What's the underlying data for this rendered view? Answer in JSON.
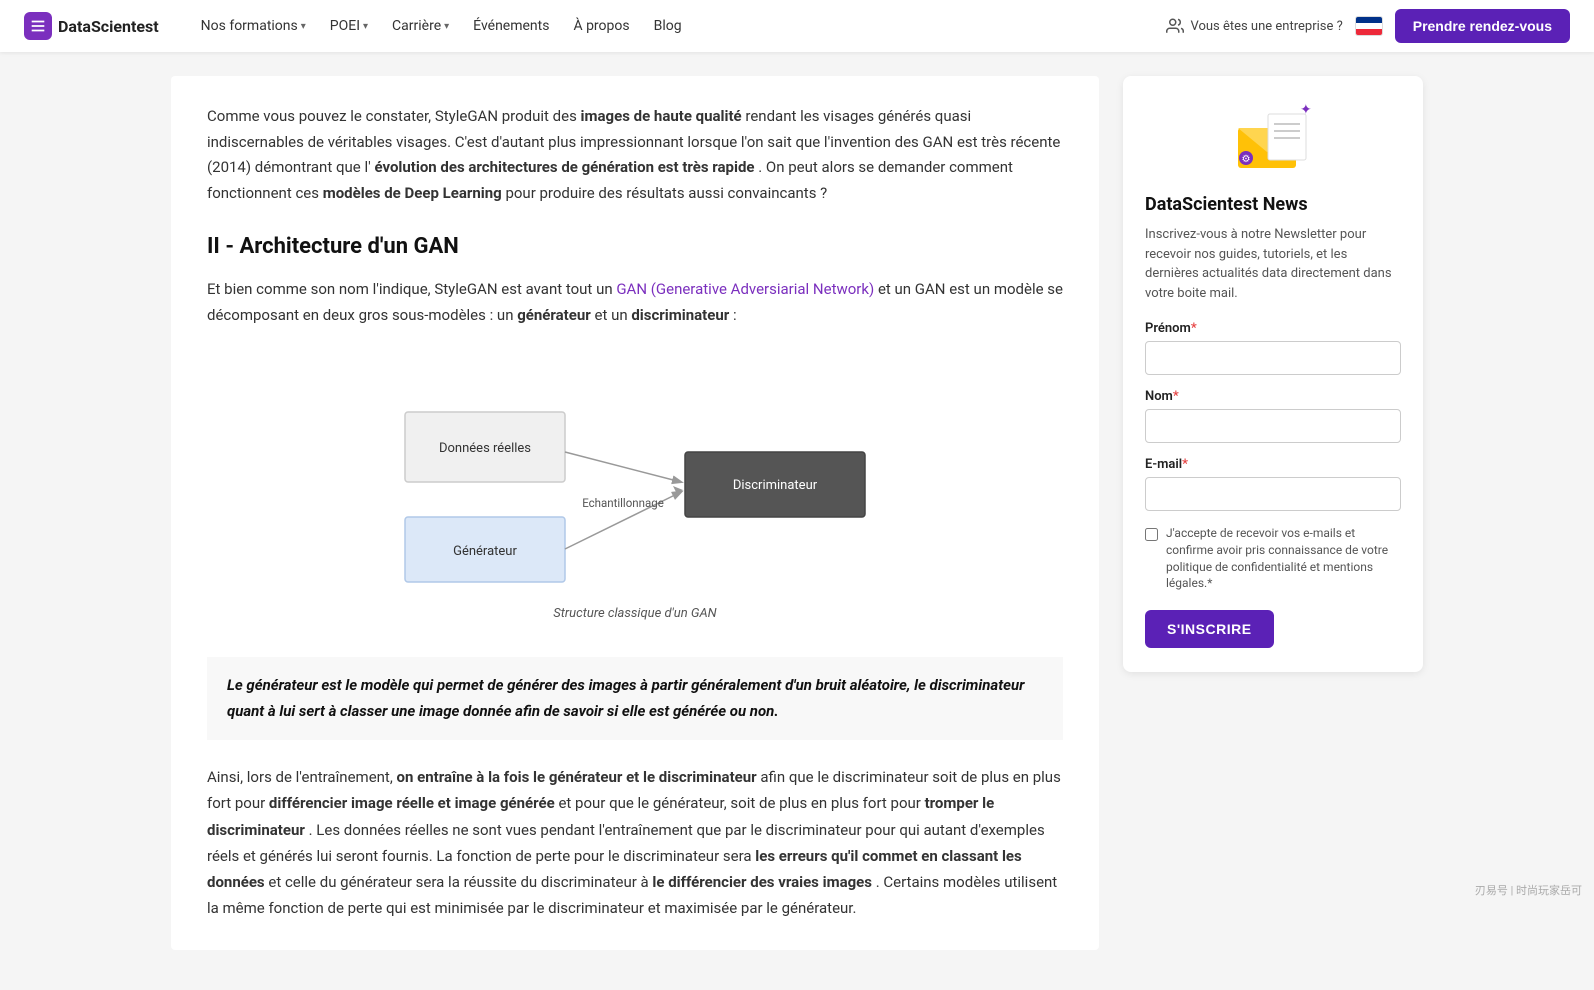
{
  "nav": {
    "logo_text": "DataScientest",
    "links": [
      {
        "label": "Nos formations",
        "has_dropdown": true
      },
      {
        "label": "POEI",
        "has_dropdown": true
      },
      {
        "label": "Carrière",
        "has_dropdown": true
      },
      {
        "label": "Événements",
        "has_dropdown": false
      },
      {
        "label": "À propos",
        "has_dropdown": false
      },
      {
        "label": "Blog",
        "has_dropdown": false
      }
    ],
    "enterprise_label": "Vous êtes une entreprise ?",
    "cta_label": "Prendre rendez-vous"
  },
  "main": {
    "intro_para": {
      "prefix": "Comme vous pouvez le constater, StyleGAN produit des ",
      "bold1": "images de haute qualité",
      "middle1": " rendant les visages générés quasi indiscernables de véritables visages. C'est d'autant plus impressionnant lorsque l'on sait que l'invention des GAN est très récente (2014) démontrant que l'",
      "bold2": "évolution des architectures de génération est très rapide",
      "end": ". On peut alors se demander comment fonctionnent ces ",
      "bold3": "modèles de Deep Learning",
      "suffix": " pour produire des résultats aussi convaincants ?"
    },
    "section_title": "II - Architecture d'un GAN",
    "section_para1": {
      "prefix": "Et bien comme son nom l'indique, StyleGAN est avant tout un ",
      "link_text": "GAN (Generative Adversiarial Network)",
      "middle": " et un GAN est un modèle se décomposant en deux gros sous-modèles : un ",
      "bold1": "générateur",
      "middle2": " et un ",
      "bold2": "discriminateur",
      "suffix": " :"
    },
    "diagram_caption": "Structure classique d'un GAN",
    "diagram": {
      "box_donnees": "Données réelles",
      "box_generateur": "Générateur",
      "box_discriminateur": "Discriminateur",
      "label_echantillonnage": "Echantillonnage"
    },
    "highlight": "Le générateur est le modèle qui permet de générer des images à partir généralement d'un bruit aléatoire, le discriminateur quant à lui sert à classer une image donnée afin de savoir si elle est générée ou non.",
    "bottom_para": {
      "prefix": "Ainsi, lors de l'entraînement, ",
      "bold1": "on entraîne à la fois le générateur et le discriminateur",
      "middle1": " afin que le discriminateur soit de plus en plus fort pour ",
      "bold2": "différencier image réelle et image générée",
      "middle2": " et pour que le générateur, soit de plus en plus fort pour ",
      "bold3": "tromper le discriminateur",
      "middle3": ". Les données réelles ne sont vues pendant l'entraînement que par le discriminateur pour qui autant d'exemples réels et générés lui seront fournis. La fonction de perte pour le discriminateur sera ",
      "bold4": "les erreurs qu'il commet en classant les données",
      "middle4": " et celle du générateur sera la réussite du discriminateur à ",
      "bold5": "le différencier des vraies images",
      "suffix": ". Certains modèles utilisent la même fonction de perte qui est minimisée par le discriminateur et maximisée par le générateur."
    }
  },
  "sidebar": {
    "news_title": "DataScientest News",
    "news_desc": "Inscrivez-vous à notre Newsletter pour recevoir nos guides, tutoriels, et les dernières actualités data directement dans votre boite mail.",
    "form": {
      "prenom_label": "Prénom",
      "prenom_required": "*",
      "nom_label": "Nom",
      "nom_required": "*",
      "email_label": "E-mail",
      "email_required": "*",
      "checkbox_label": "J'accepte de recevoir vos e-mails et confirme avoir pris connaissance de votre politique de confidentialité et mentions légales.",
      "checkbox_required": "*",
      "submit_label": "S'INSCRIRE"
    }
  },
  "watermark": "刃易号 | 时尚玩家岳可"
}
